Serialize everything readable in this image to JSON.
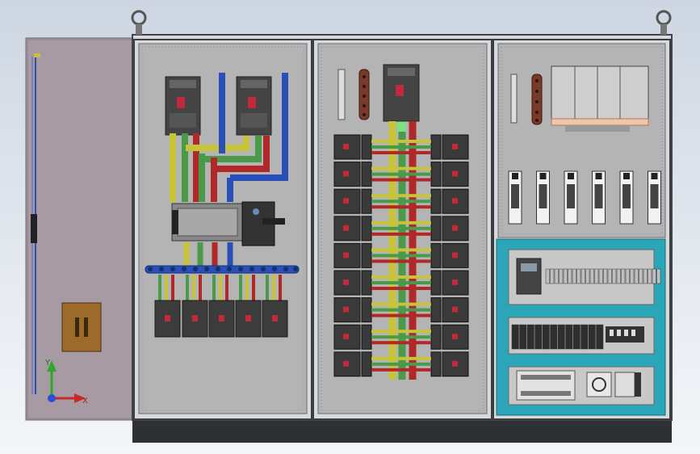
{
  "triad": {
    "x_label": "X",
    "y_label": "Y"
  },
  "colors": {
    "phase_yellow": "#c8c43a",
    "phase_green": "#4a9a4a",
    "phase_red": "#b02828",
    "neutral_blue": "#2a4fb8",
    "plate_gray": "#b4b4b4",
    "cabinet_frame": "#555a60",
    "teal_panel": "#2aa6b8"
  },
  "panels": {
    "left_breaker_count_bottom": 5,
    "middle_breaker_rows": 9,
    "right_fuse_count": 6
  }
}
